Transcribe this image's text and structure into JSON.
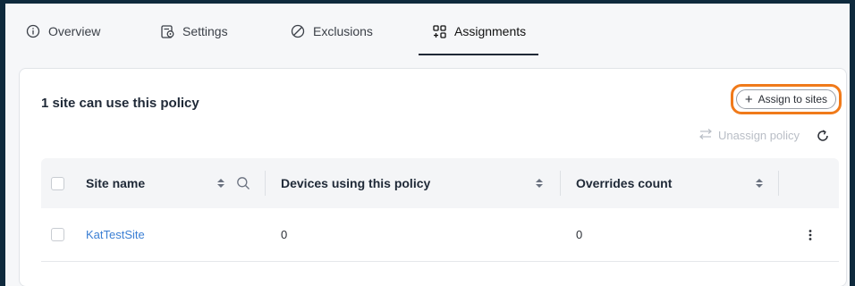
{
  "tabs": [
    {
      "label": "Overview",
      "icon": "info-circle-icon"
    },
    {
      "label": "Settings",
      "icon": "settings-gear-doc-icon"
    },
    {
      "label": "Exclusions",
      "icon": "prohibit-icon"
    },
    {
      "label": "Assignments",
      "icon": "grid-plus-icon",
      "active": true
    }
  ],
  "card": {
    "title": "1 site can use this policy",
    "assign_button": "Assign to sites",
    "unassign_button": "Unassign policy"
  },
  "table": {
    "columns": [
      "Site name",
      "Devices using this policy",
      "Overrides count"
    ],
    "rows": [
      {
        "site_name": "KatTestSite",
        "devices": "0",
        "overrides": "0"
      }
    ]
  },
  "colors": {
    "highlight": "#f07a1a",
    "link": "#3b7fd4",
    "frame": "#0f2a3d"
  }
}
